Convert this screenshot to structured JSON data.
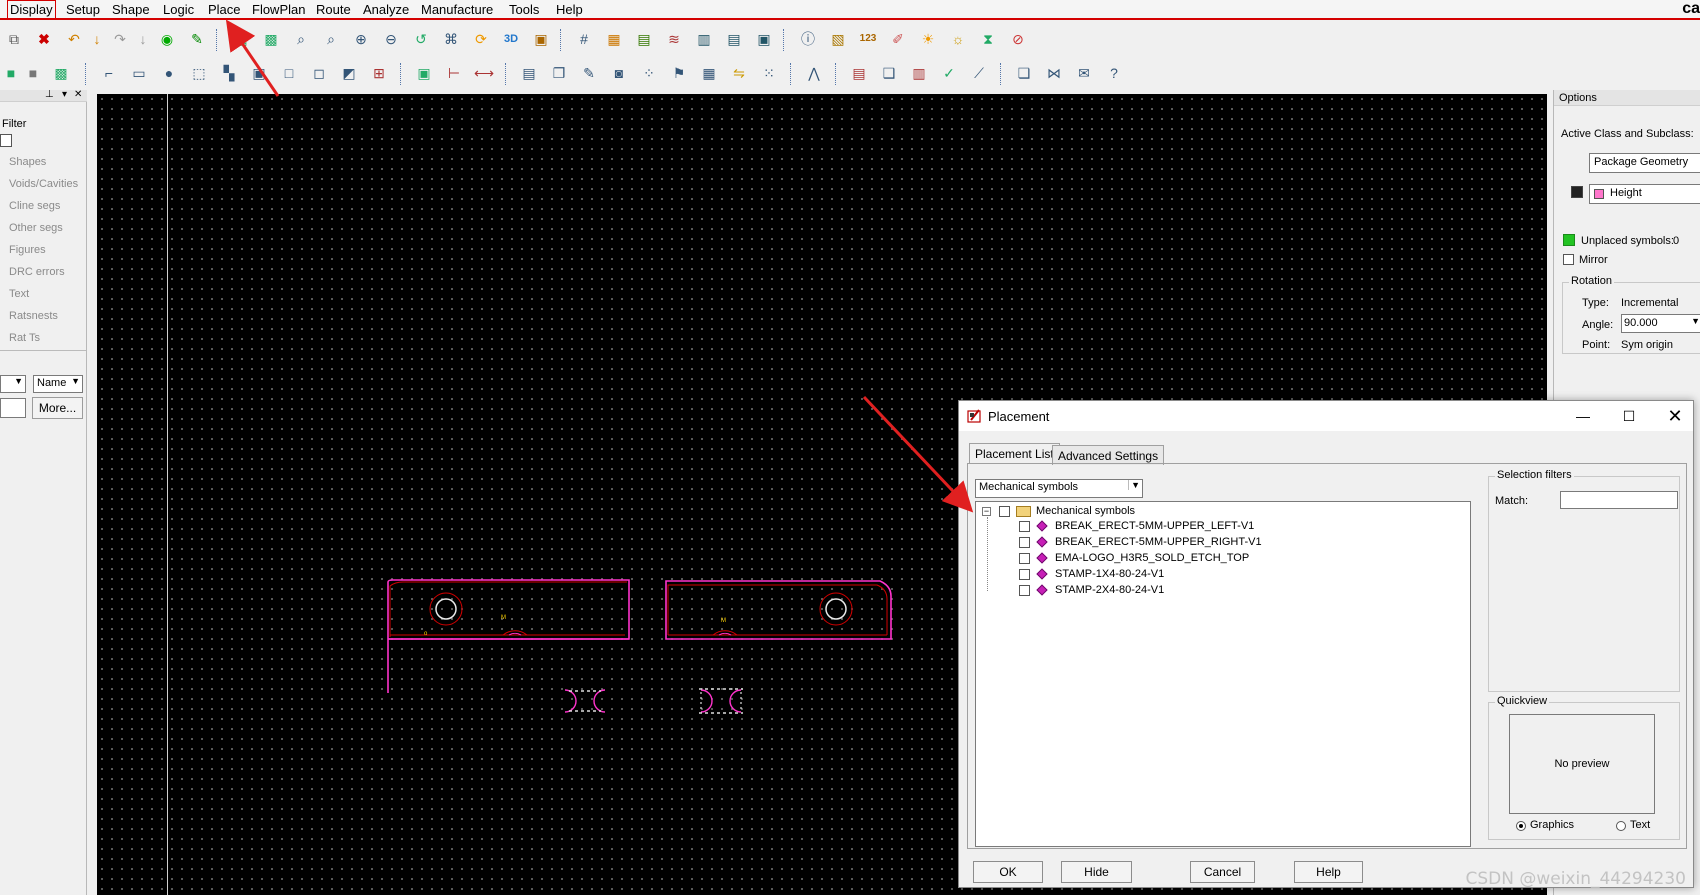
{
  "menubar": {
    "items": [
      "Display",
      "Setup",
      "Shape",
      "Logic",
      "Place",
      "FlowPlan",
      "Route",
      "Analyze",
      "Manufacture",
      "Tools",
      "Help"
    ],
    "active": "Display",
    "corner_text": "ca"
  },
  "filter": {
    "title": "Filter",
    "items": [
      "Shapes",
      "Voids/Cavities",
      "Cline segs",
      "Other segs",
      "Figures",
      "DRC errors",
      "Text",
      "Ratsnests",
      "Rat Ts"
    ],
    "name_select": "Name",
    "more_button": "More..."
  },
  "options": {
    "title": "Options",
    "active_class_label": "Active Class and Subclass:",
    "class_value": "Package Geometry",
    "subclass_value": "Height",
    "unplaced_label": "Unplaced symbols:",
    "unplaced_count": "0",
    "mirror_label": "Mirror",
    "rotation": {
      "title": "Rotation",
      "type_label": "Type:",
      "type_value": "Incremental",
      "angle_label": "Angle:",
      "angle_value": "90.000",
      "point_label": "Point:",
      "point_value": "Sym origin"
    }
  },
  "dialog": {
    "title": "Placement",
    "tabs": [
      "Placement List",
      "Advanced Settings"
    ],
    "category_select": "Mechanical symbols",
    "tree_root": "Mechanical symbols",
    "tree_items": [
      "BREAK_ERECT-5MM-UPPER_LEFT-V1",
      "BREAK_ERECT-5MM-UPPER_RIGHT-V1",
      "EMA-LOGO_H3R5_SOLD_ETCH_TOP",
      "STAMP-1X4-80-24-V1",
      "STAMP-2X4-80-24-V1"
    ],
    "selection_filters": {
      "title": "Selection filters",
      "match_label": "Match:",
      "match_value": ""
    },
    "quickview": {
      "title": "Quickview",
      "no_preview": "No preview",
      "radio_graphics": "Graphics",
      "radio_text": "Text"
    },
    "buttons": {
      "ok": "OK",
      "hide": "Hide",
      "cancel": "Cancel",
      "help": "Help"
    }
  },
  "watermark": "CSDN @weixin_44294230",
  "colors": {
    "menu_underline": "#d40000",
    "outline_magenta": "#ff33cc",
    "outline_red": "#d40000",
    "unplaced_green": "#22c322",
    "height_swatch": "#ff77cc",
    "arrow_red": "#e02020"
  }
}
